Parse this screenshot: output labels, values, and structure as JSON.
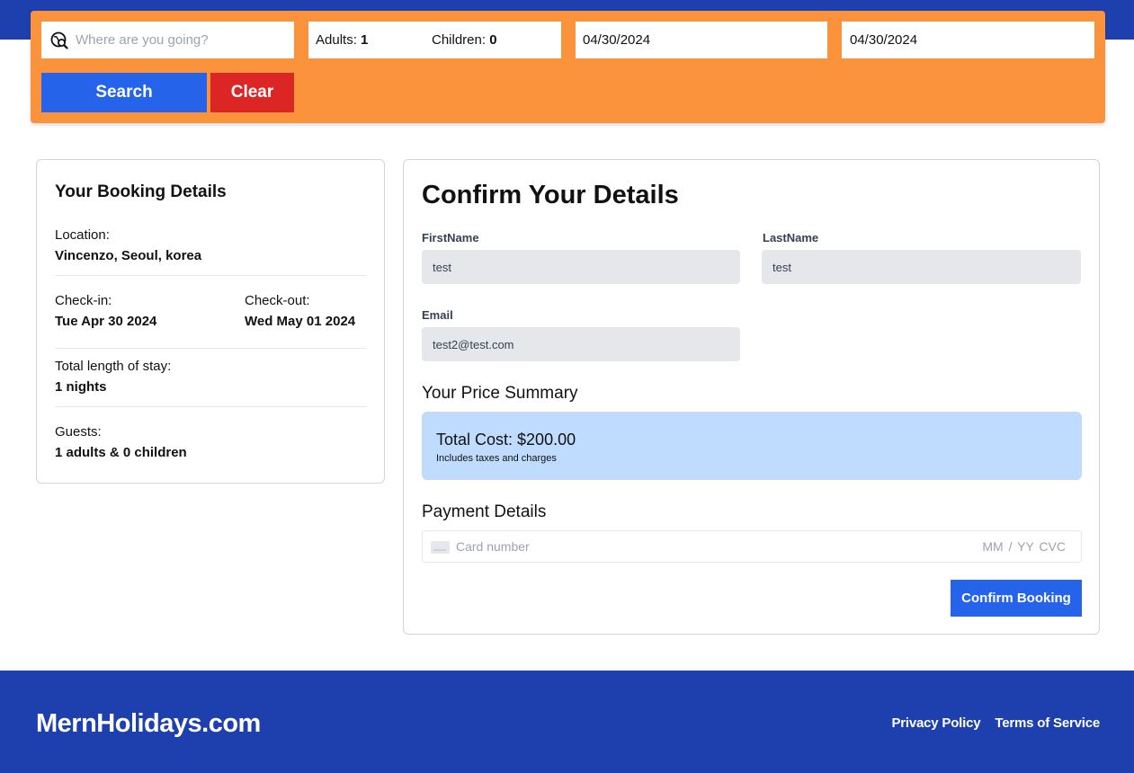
{
  "search": {
    "destination_placeholder": "Where are you going?",
    "adults_label": "Adults:",
    "adults_value": "1",
    "children_label": "Children:",
    "children_value": "0",
    "check_in_date": "04/30/2024",
    "check_out_date": "04/30/2024",
    "search_label": "Search",
    "clear_label": "Clear"
  },
  "booking": {
    "title": "Your Booking Details",
    "location_label": "Location:",
    "location_value": "Vincenzo, Seoul, korea",
    "check_in_label": "Check-in:",
    "check_in_value": "Tue Apr 30 2024",
    "check_out_label": "Check-out:",
    "check_out_value": "Wed May 01 2024",
    "stay_label": "Total length of stay:",
    "stay_value": "1 nights",
    "guests_label": "Guests:",
    "guests_value": "1 adults & 0 children"
  },
  "confirm": {
    "title": "Confirm Your Details",
    "first_name_label": "FirstName",
    "first_name_value": "test",
    "last_name_label": "LastName",
    "last_name_value": "test",
    "email_label": "Email",
    "email_value": "test2@test.com",
    "price_title": "Your Price Summary",
    "total_cost": "Total Cost: $200.00",
    "price_note": "Includes taxes and charges",
    "payment_title": "Payment Details",
    "card_placeholder": "Card number",
    "expiry_cvc_placeholder": "MM / YY  CVC",
    "confirm_label": "Confirm Booking"
  },
  "footer": {
    "logo": "MernHolidays.com",
    "privacy": "Privacy Policy",
    "terms": "Terms of Service"
  },
  "colors": {
    "header_blue": "#1e40af",
    "search_orange": "#fb923c",
    "primary_blue": "#2563eb",
    "clear_red": "#dc2626",
    "price_box": "#bfdbfe"
  },
  "icons": {
    "destination": "map-search-icon",
    "card": "credit-card-icon"
  }
}
